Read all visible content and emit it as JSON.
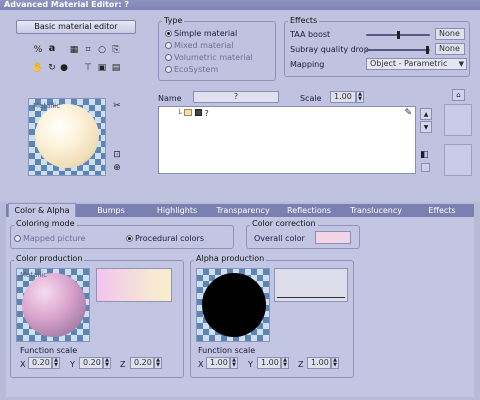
{
  "window": {
    "title": "Advanced Material Editor: ?"
  },
  "toolbar": {
    "basic_editor_label": "Basic material editor",
    "icons": [
      "percent-icon",
      "text-a-icon",
      "grid-icon",
      "crop-icon",
      "bulb-icon",
      "copy-icon",
      "hand-icon",
      "rotate-icon",
      "person-icon",
      "camera-icon",
      "film-icon",
      "film-strip-icon"
    ]
  },
  "preview": {
    "overlay_label": "Metallic"
  },
  "type_group": {
    "title": "Type",
    "options": [
      {
        "label": "Simple material",
        "selected": true,
        "enabled": true
      },
      {
        "label": "Mixed material",
        "selected": false,
        "enabled": false
      },
      {
        "label": "Volumetric material",
        "selected": false,
        "enabled": false
      },
      {
        "label": "EcoSystem",
        "selected": false,
        "enabled": false
      }
    ]
  },
  "effects_group": {
    "title": "Effects",
    "taa_label": "TAA boost",
    "taa_value": "None",
    "taa_level": 0.5,
    "subray_label": "Subray quality drop",
    "subray_value": "None",
    "subray_level": 0.98,
    "mapping_label": "Mapping",
    "mapping_value": "Object - Parametric"
  },
  "name_row": {
    "name_label": "Name",
    "name_value": "?",
    "scale_label": "Scale",
    "scale_value": "1.00"
  },
  "tree": {
    "item_label": "?"
  },
  "tabs": [
    {
      "label": "Color & Alpha",
      "active": true
    },
    {
      "label": "Bumps",
      "active": false
    },
    {
      "label": "Highlights",
      "active": false
    },
    {
      "label": "Transparency",
      "active": false
    },
    {
      "label": "Reflections",
      "active": false
    },
    {
      "label": "Translucency",
      "active": false
    },
    {
      "label": "Effects",
      "active": false
    }
  ],
  "coloring_mode": {
    "title": "Coloring mode",
    "option_mapped": "Mapped picture",
    "option_procedural": "Procedural colors",
    "selected": "Procedural colors"
  },
  "color_correction": {
    "title": "Color correction",
    "overall_label": "Overall color",
    "overall_color": "#f3d3e6"
  },
  "color_production": {
    "title": "Color production",
    "preview_label": "Metallic",
    "function_scale_label": "Function scale",
    "x_label": "X",
    "x_value": "0.20",
    "y_label": "Y",
    "y_value": "0.20",
    "z_label": "Z",
    "z_value": "0.20"
  },
  "alpha_production": {
    "title": "Alpha production",
    "function_scale_label": "Function scale",
    "x_label": "X",
    "x_value": "1.00",
    "y_label": "Y",
    "y_value": "1.00",
    "z_label": "Z",
    "z_value": "1.00"
  },
  "colors": {
    "background": "#b7bbd8",
    "title_bar": "#7e84b3",
    "tab_bar": "#7a80b0",
    "panel": "#c2c6e2",
    "swatch_light": "#f3d3e6"
  }
}
